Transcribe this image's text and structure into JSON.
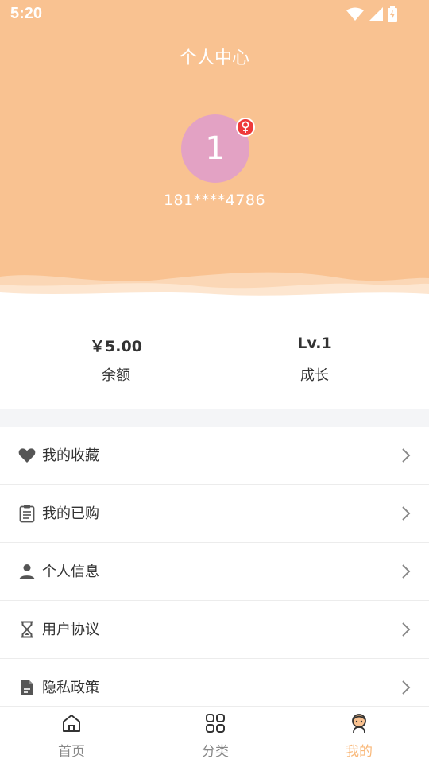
{
  "status_bar": {
    "time": "5:20",
    "icons": [
      "wifi-icon",
      "signal-icon",
      "battery-charging-icon"
    ]
  },
  "header": {
    "title": "个人中心",
    "avatar_text": "1",
    "gender_icon": "female-icon",
    "phone": "181****4786",
    "background_color": "#f9c291",
    "avatar_color": "#e3a2c4"
  },
  "stats": [
    {
      "value": "￥5.00",
      "label": "余额"
    },
    {
      "value": "Lv.1",
      "label": "成长"
    }
  ],
  "menu": [
    {
      "label": "我的收藏",
      "icon": "heart-icon"
    },
    {
      "label": "我的已购",
      "icon": "clipboard-icon"
    },
    {
      "label": "个人信息",
      "icon": "person-icon"
    },
    {
      "label": "用户协议",
      "icon": "hourglass-icon"
    },
    {
      "label": "隐私政策",
      "icon": "document-icon"
    }
  ],
  "tabbar": [
    {
      "label": "首页",
      "icon": "home-icon",
      "active": false
    },
    {
      "label": "分类",
      "icon": "grid-icon",
      "active": false
    },
    {
      "label": "我的",
      "icon": "profile-icon",
      "active": true
    }
  ],
  "colors": {
    "accent": "#f9b879",
    "badge": "#ee3a3a"
  }
}
